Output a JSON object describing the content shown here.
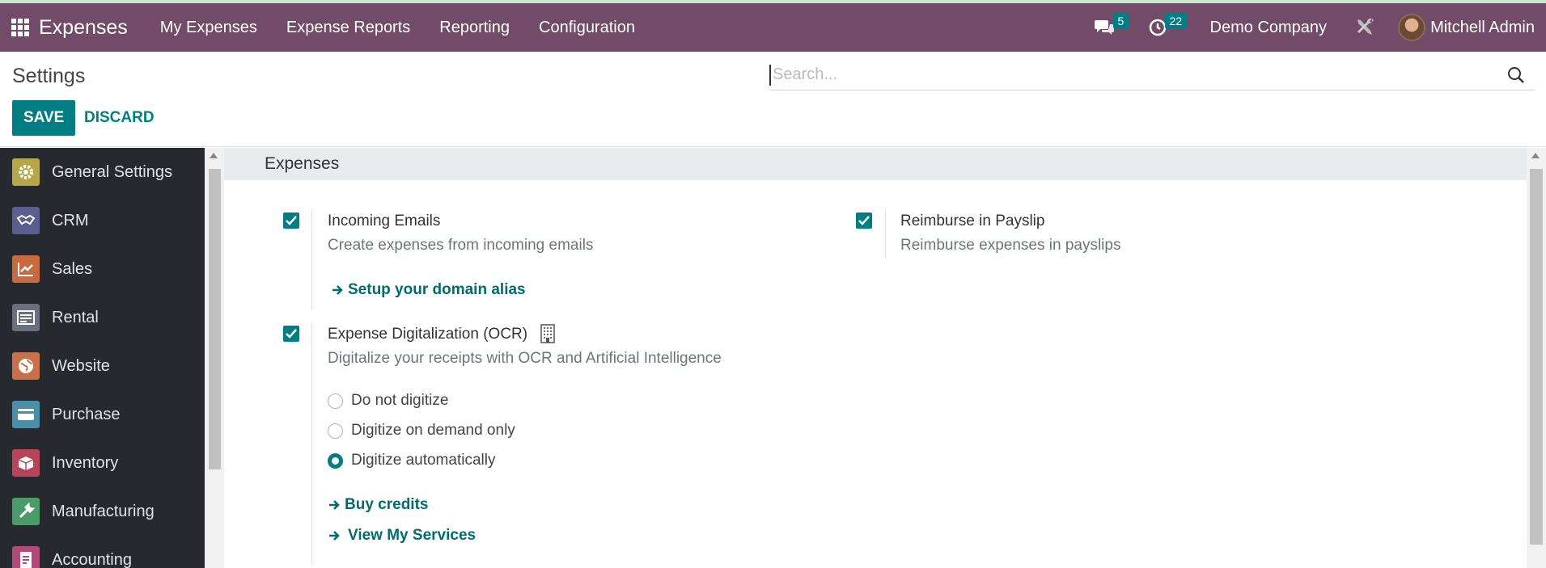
{
  "navbar": {
    "app_name": "Expenses",
    "menu": [
      "My Expenses",
      "Expense Reports",
      "Reporting",
      "Configuration"
    ],
    "messages_count": "5",
    "activities_count": "22",
    "company": "Demo Company",
    "user": "Mitchell Admin"
  },
  "control": {
    "title": "Settings",
    "search_placeholder": "Search...",
    "save_label": "SAVE",
    "discard_label": "DISCARD"
  },
  "sidebar": {
    "items": [
      {
        "label": "General Settings",
        "icon": "gear-icon",
        "color": "#b5a64a"
      },
      {
        "label": "CRM",
        "icon": "handshake-icon",
        "color": "#5b5f8f"
      },
      {
        "label": "Sales",
        "icon": "chart-icon",
        "color": "#c86a3e"
      },
      {
        "label": "Rental",
        "icon": "rental-icon",
        "color": "#6a6f80"
      },
      {
        "label": "Website",
        "icon": "globe-icon",
        "color": "#c8704a"
      },
      {
        "label": "Purchase",
        "icon": "card-icon",
        "color": "#4a8fa8"
      },
      {
        "label": "Inventory",
        "icon": "box-icon",
        "color": "#b8445a"
      },
      {
        "label": "Manufacturing",
        "icon": "wrench-icon",
        "color": "#4a9a6a"
      },
      {
        "label": "Accounting",
        "icon": "document-icon",
        "color": "#b04a7a"
      }
    ]
  },
  "main": {
    "section_title": "Expenses",
    "incoming_emails": {
      "title": "Incoming Emails",
      "desc": "Create expenses from incoming emails",
      "link": "Setup your domain alias"
    },
    "reimburse": {
      "title": "Reimburse in Payslip",
      "desc": "Reimburse expenses in payslips"
    },
    "ocr": {
      "title": "Expense Digitalization (OCR)",
      "desc": "Digitalize your receipts with OCR and Artificial Intelligence",
      "options": [
        "Do not digitize",
        "Digitize on demand only",
        "Digitize automatically"
      ],
      "selected": "Digitize automatically",
      "link_credits": "Buy credits",
      "link_services": "View My Services"
    }
  },
  "colors": {
    "navbar": "#714B67",
    "accent": "#017e84",
    "sidebar": "#262a2f"
  }
}
